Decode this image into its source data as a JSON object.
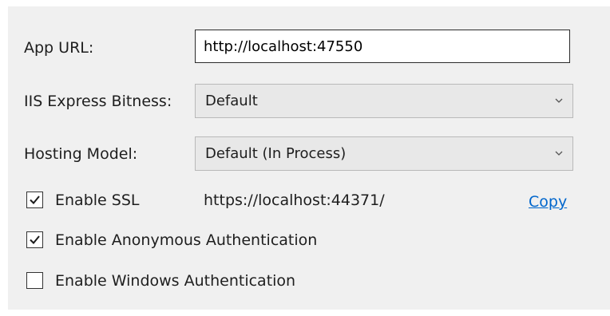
{
  "fields": {
    "app_url": {
      "label": "App URL:",
      "value": "http://localhost:47550"
    },
    "iis_bitness": {
      "label": "IIS Express Bitness:",
      "selected": "Default"
    },
    "hosting_model": {
      "label": "Hosting Model:",
      "selected": "Default (In Process)"
    }
  },
  "checkboxes": {
    "enable_ssl": {
      "label": "Enable SSL",
      "checked": true,
      "url": "https://localhost:44371/",
      "copy_label": "Copy"
    },
    "anonymous_auth": {
      "label": "Enable Anonymous Authentication",
      "checked": true
    },
    "windows_auth": {
      "label": "Enable Windows Authentication",
      "checked": false
    }
  },
  "icons": {
    "dropdown": "chevron-down-icon",
    "check": "checkmark-icon"
  },
  "colors": {
    "panel_background": "#f0f0f0",
    "link": "#0066cc",
    "combo_background": "#e8e8e8"
  }
}
